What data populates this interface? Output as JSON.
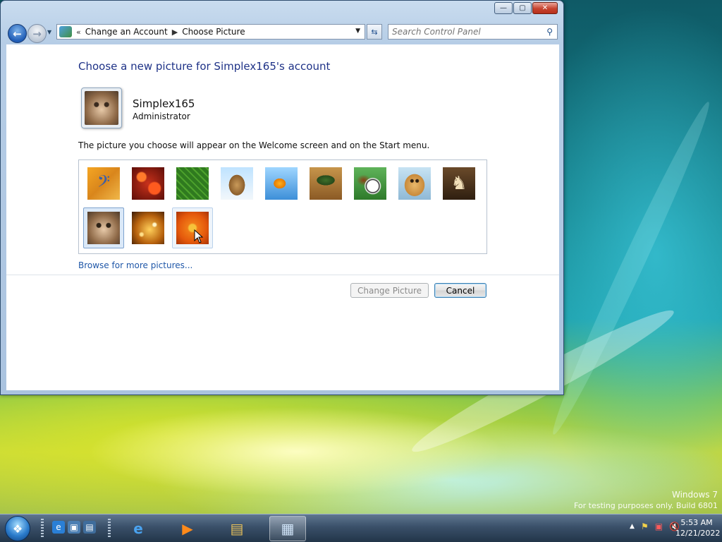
{
  "window": {
    "address_bar": {
      "overflow_glyph": "«",
      "crumbs": [
        "Change an Account",
        "Choose Picture"
      ]
    },
    "search": {
      "placeholder": "Search Control Panel"
    },
    "heading": "Choose a new picture for Simplex165's account",
    "account": {
      "name": "Simplex165",
      "role": "Administrator"
    },
    "description": "The picture you choose will appear on the Welcome screen and on the Start menu.",
    "pictures": [
      {
        "name": "bass-clef",
        "selected": false
      },
      {
        "name": "red-coral",
        "selected": false
      },
      {
        "name": "green-leaf",
        "selected": false
      },
      {
        "name": "robot",
        "selected": false
      },
      {
        "name": "goldfish",
        "selected": false
      },
      {
        "name": "bonsai",
        "selected": false
      },
      {
        "name": "sports-balls",
        "selected": false
      },
      {
        "name": "puppy",
        "selected": false
      },
      {
        "name": "chess-pieces",
        "selected": false
      },
      {
        "name": "kitten",
        "selected": true
      },
      {
        "name": "sparkles",
        "selected": false
      },
      {
        "name": "orange-flower",
        "selected": false,
        "hover": true
      }
    ],
    "browse_link": "Browse for more pictures...",
    "buttons": {
      "change_picture": "Change Picture",
      "cancel": "Cancel"
    }
  },
  "desktop": {
    "watermark_line1": "Windows 7",
    "watermark_line2": "For testing purposes only. Build 6801"
  },
  "taskbar": {
    "clock_time": "5:53 AM",
    "clock_date": "12/21/2022"
  },
  "colors": {
    "heading": "#1e3287",
    "link": "#1f57a8",
    "selection": "#dbe9f8"
  }
}
